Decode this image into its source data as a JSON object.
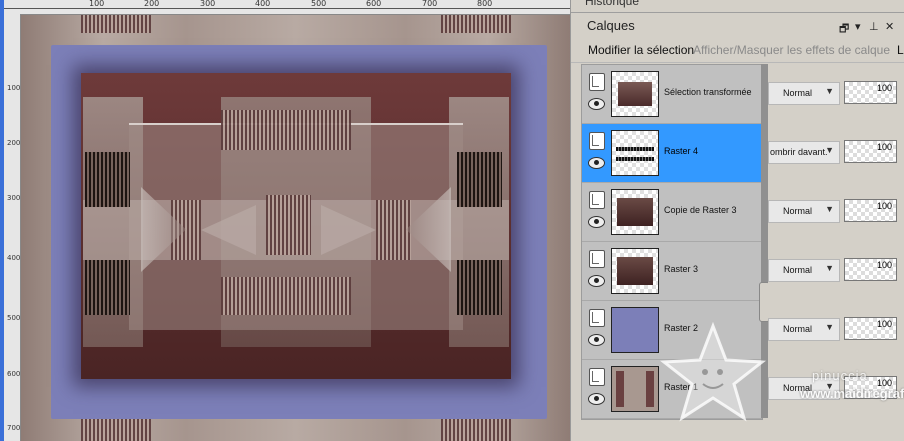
{
  "rulers": {
    "top_labels": [
      "100",
      "200",
      "300",
      "400",
      "500",
      "600",
      "700",
      "800"
    ],
    "left_labels": [
      "100",
      "200",
      "300",
      "400",
      "500",
      "600",
      "700"
    ]
  },
  "panel": {
    "historique_title": "Historique",
    "calques_title": "Calques",
    "toolbar": {
      "modify_selection": "Modifier la sélection",
      "toggle_effects": "Afficher/Masquer les effets de calque",
      "link": "Li"
    }
  },
  "layers": [
    {
      "name": "Sélection transformée",
      "blend": "Normal",
      "opacity": "100",
      "selected": false
    },
    {
      "name": "Raster 4",
      "blend": "ombrir davant.",
      "opacity": "100",
      "selected": true
    },
    {
      "name": "Copie de Raster 3",
      "blend": "Normal",
      "opacity": "100",
      "selected": false
    },
    {
      "name": "Raster 3",
      "blend": "Normal",
      "opacity": "100",
      "selected": false
    },
    {
      "name": "Raster 2",
      "blend": "Normal",
      "opacity": "100",
      "selected": false
    },
    {
      "name": "Raster 1",
      "blend": "Normal",
      "opacity": "100",
      "selected": false
    }
  ],
  "watermark": {
    "name": "pinuccia",
    "url": "www.maidiregrafica"
  },
  "colors": {
    "selection": "#3399ff",
    "frame_blue": "#7c7fb8",
    "frame_dark": "#5a2e2e"
  }
}
